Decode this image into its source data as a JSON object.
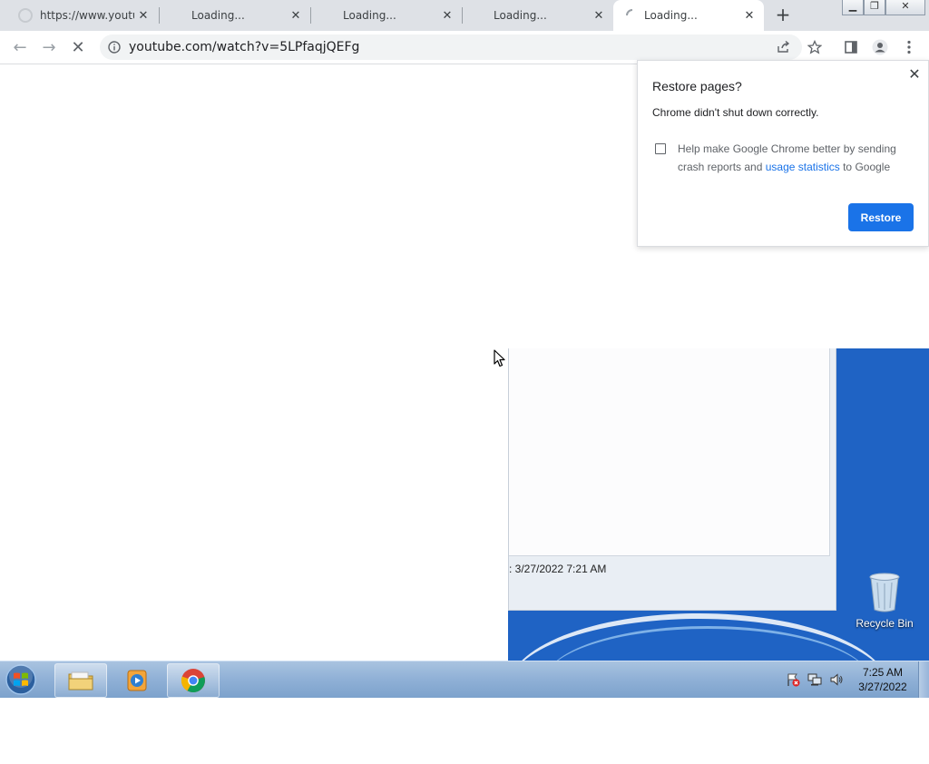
{
  "browser": {
    "tabs": [
      {
        "title": "https://www.youtube.com/watch?v=5LPfaqjQEFg",
        "active": false
      },
      {
        "title": "Loading...",
        "active": false
      },
      {
        "title": "Loading...",
        "active": false
      },
      {
        "title": "Loading...",
        "active": false
      },
      {
        "title": "Loading...",
        "active": true
      }
    ],
    "url": "youtube.com/watch?v=5LPfaqjQEFg"
  },
  "restore_popup": {
    "title": "Restore pages?",
    "message": "Chrome didn't shut down correctly.",
    "help_prefix": "Help make Google Chrome better by sending crash reports and ",
    "help_link": "usage statistics",
    "help_suffix": " to Google",
    "checkbox_checked": false,
    "button": "Restore"
  },
  "background_window": {
    "time_text": ": 3/27/2022 7:21 AM"
  },
  "desktop": {
    "recycle_bin_label": "Recycle Bin"
  },
  "taskbar": {
    "time": "7:25 AM",
    "date": "3/27/2022"
  },
  "colors": {
    "accent": "#1a73e8",
    "desktop": "#1f63c4",
    "tabstrip": "#dee1e6"
  }
}
